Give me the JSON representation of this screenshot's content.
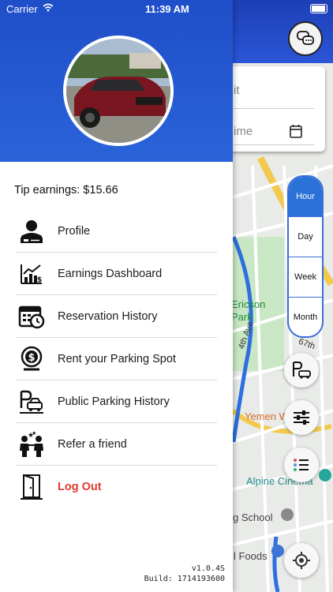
{
  "status_bar": {
    "carrier": "Carrier",
    "time": "11:39 AM"
  },
  "drawer": {
    "tip_label": "Tip earnings: $15.66",
    "menu": [
      {
        "label": "Profile",
        "icon": "profile-icon"
      },
      {
        "label": "Earnings Dashboard",
        "icon": "chart-icon"
      },
      {
        "label": "Reservation History",
        "icon": "calendar-clock-icon"
      },
      {
        "label": "Rent your Parking Spot",
        "icon": "dollar-coin-icon"
      },
      {
        "label": "Public Parking History",
        "icon": "parking-car-icon"
      },
      {
        "label": "Refer a friend",
        "icon": "people-icon"
      },
      {
        "label": "Log Out",
        "icon": "door-icon"
      }
    ],
    "version": "v1.0.4S",
    "build": "Build: 1714193600"
  },
  "search": {
    "field1_placeholder": "it",
    "field2_placeholder": "ime"
  },
  "segment": [
    "Hour",
    "Day",
    "Week",
    "Month"
  ],
  "map_labels": {
    "ericson": "Ericson",
    "park": "Park",
    "ave": "4th Ave",
    "st67": "67th",
    "yemen": "Yemen W",
    "alpine": "Alpine Cinema",
    "school": "g School",
    "foods": "l Foods"
  },
  "colors": {
    "header": "#2a5fd6",
    "logout": "#e03b2e",
    "segment_active": "#2b72d8"
  }
}
